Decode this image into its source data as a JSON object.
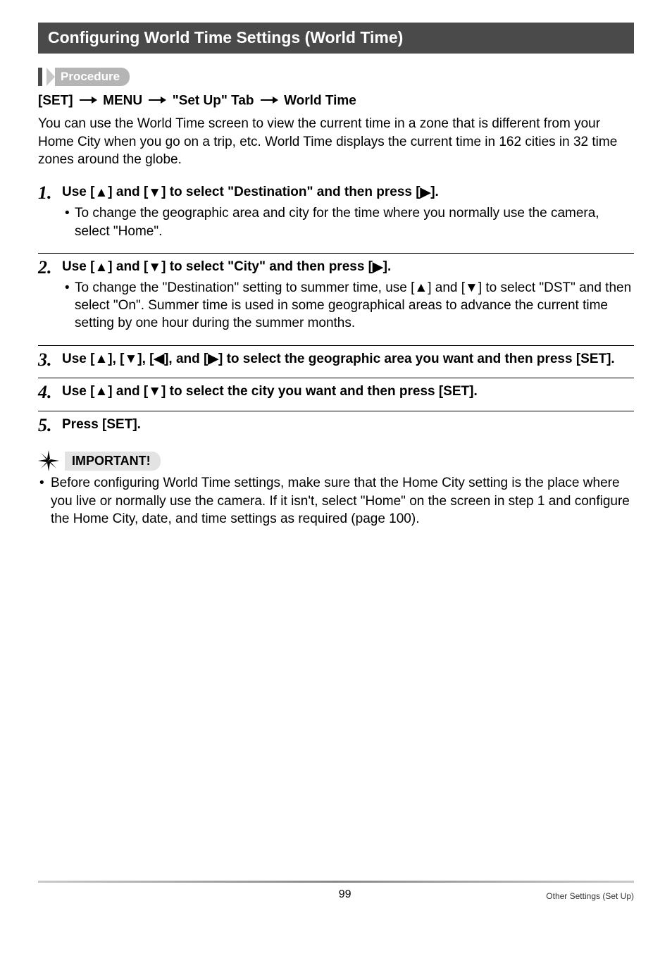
{
  "section_title": "Configuring World Time Settings (World Time)",
  "procedure_label": "Procedure",
  "nav": {
    "p1": "[SET]",
    "p2": "MENU",
    "p3": "\"Set Up\" Tab",
    "p4": "World Time"
  },
  "intro": "You can use the World Time screen to view the current time in a zone that is different from your Home City when you go on a trip, etc. World Time displays the current time in 162 cities in 32 time zones around the globe.",
  "steps": [
    {
      "num": "1.",
      "instr_pre": "Use [",
      "instr_mid1": "] and [",
      "instr_mid2": "] to select \"Destination\" and then press [",
      "instr_end": "].",
      "bullets": [
        "To change the geographic area and city for the time where you normally use the camera, select \"Home\"."
      ]
    },
    {
      "num": "2.",
      "instr_pre": "Use [",
      "instr_mid1": "] and [",
      "instr_mid2": "] to select \"City\" and then press [",
      "instr_end": "].",
      "bullets": [
        "To change the \"Destination\" setting to summer time, use [▲] and [▼] to select \"DST\" and then select \"On\". Summer time is used in some geographical areas to advance the current time setting by one hour during the summer months."
      ]
    },
    {
      "num": "3.",
      "instr_full": "Use [▲], [▼], [◀], and [▶] to select the geographic area you want and then press [SET].",
      "bullets": []
    },
    {
      "num": "4.",
      "instr_full": "Use [▲] and [▼] to select the city you want and then press [SET].",
      "bullets": []
    },
    {
      "num": "5.",
      "instr_full": "Press [SET].",
      "bullets": []
    }
  ],
  "important_label": "IMPORTANT!",
  "important_body": "Before configuring World Time settings, make sure that the Home City setting is the place where you live or normally use the camera. If it isn't, select \"Home\" on the screen in step 1 and configure the Home City, date, and time settings as required (page 100).",
  "footer": {
    "page": "99",
    "section": "Other Settings (Set Up)"
  }
}
